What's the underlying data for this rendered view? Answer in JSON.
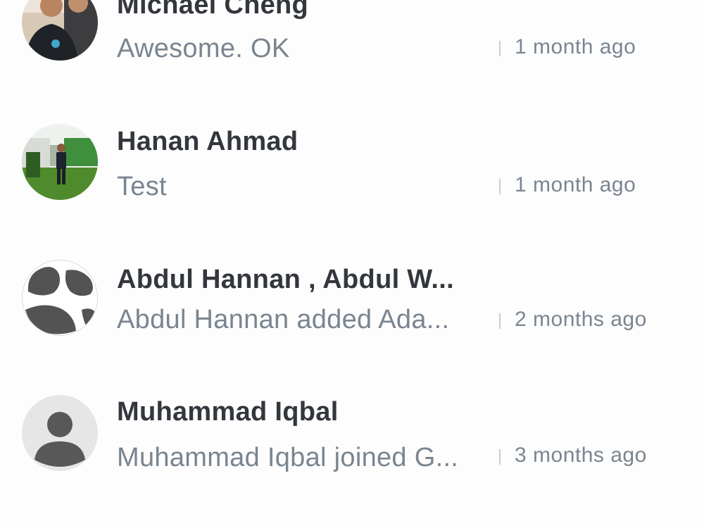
{
  "conversations": [
    {
      "name": "Michael Cheng",
      "preview": "Awesome. OK",
      "time": "1 month ago",
      "avatar": "photo-avatar"
    },
    {
      "name": "Hanan Ahmad",
      "preview": "Test",
      "time": "1 month ago",
      "avatar": "photo-avatar"
    },
    {
      "name": "Abdul Hannan , Abdul W...",
      "preview": "Abdul Hannan added Ada...",
      "time": "2 months ago",
      "avatar": "group-icon"
    },
    {
      "name": "Muhammad Iqbal",
      "preview": "Muhammad Iqbal joined G...",
      "time": "3 months ago",
      "avatar": "person-icon"
    }
  ],
  "colors": {
    "name_text": "#33373d",
    "secondary_text": "#7a8591",
    "background": "#fdfdfd"
  }
}
